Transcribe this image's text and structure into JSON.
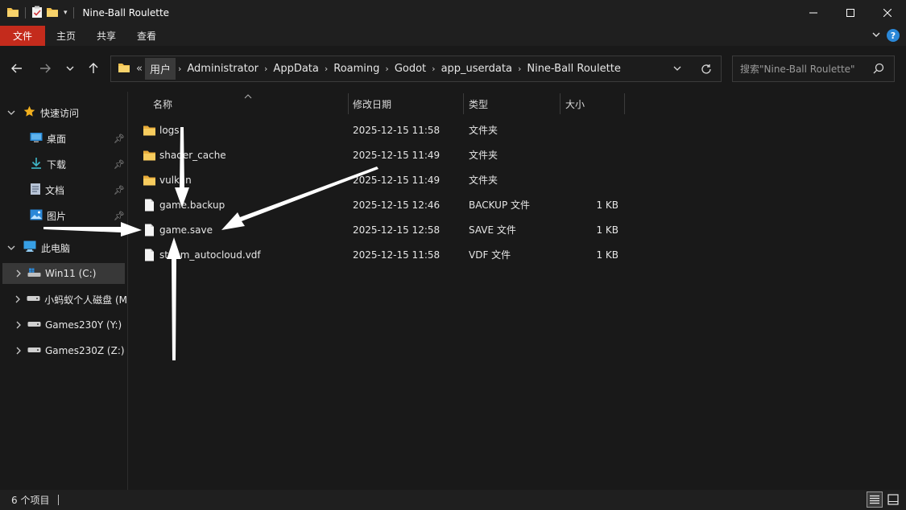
{
  "window": {
    "title": "Nine-Ball Roulette",
    "controls": {
      "minimize": "minimize-icon",
      "maximize": "maximize-icon",
      "close": "close-icon"
    }
  },
  "ribbon": {
    "tabs": [
      {
        "label": "文件",
        "active": true
      },
      {
        "label": "主页"
      },
      {
        "label": "共享"
      },
      {
        "label": "查看"
      }
    ],
    "help": "?"
  },
  "address": {
    "overflow": "«",
    "crumbs": [
      "用户",
      "Administrator",
      "AppData",
      "Roaming",
      "Godot",
      "app_userdata",
      "Nine-Ball Roulette"
    ],
    "search_placeholder": "搜索\"Nine-Ball Roulette\""
  },
  "sidebar": {
    "quick_access": "快速访问",
    "pinned": [
      {
        "label": "桌面",
        "icon": "desktop-icon"
      },
      {
        "label": "下载",
        "icon": "download-icon"
      },
      {
        "label": "文档",
        "icon": "document-icon"
      },
      {
        "label": "图片",
        "icon": "picture-icon"
      }
    ],
    "this_pc": "此电脑",
    "drives": [
      {
        "label": "Win11 (C:)",
        "selected": true
      },
      {
        "label": "小蚂蚁个人磁盘 (M"
      },
      {
        "label": "Games230Y (Y:)"
      },
      {
        "label": "Games230Z (Z:)"
      }
    ]
  },
  "columns": [
    "名称",
    "修改日期",
    "类型",
    "大小"
  ],
  "files": [
    {
      "name": "logs",
      "date": "2025-12-15 11:58",
      "type": "文件夹",
      "size": "",
      "kind": "folder"
    },
    {
      "name": "shader_cache",
      "date": "2025-12-15 11:49",
      "type": "文件夹",
      "size": "",
      "kind": "folder"
    },
    {
      "name": "vulkan",
      "date": "2025-12-15 11:49",
      "type": "文件夹",
      "size": "",
      "kind": "folder"
    },
    {
      "name": "game.backup",
      "date": "2025-12-15 12:46",
      "type": "BACKUP 文件",
      "size": "1 KB",
      "kind": "file"
    },
    {
      "name": "game.save",
      "date": "2025-12-15 12:58",
      "type": "SAVE 文件",
      "size": "1 KB",
      "kind": "file"
    },
    {
      "name": "steam_autocloud.vdf",
      "date": "2025-12-15 11:58",
      "type": "VDF 文件",
      "size": "1 KB",
      "kind": "file"
    }
  ],
  "status": {
    "count": "6 个项目"
  },
  "colors": {
    "accent_file_tab": "#c42b1c",
    "folder": "#f2c14e",
    "background": "#191919"
  }
}
